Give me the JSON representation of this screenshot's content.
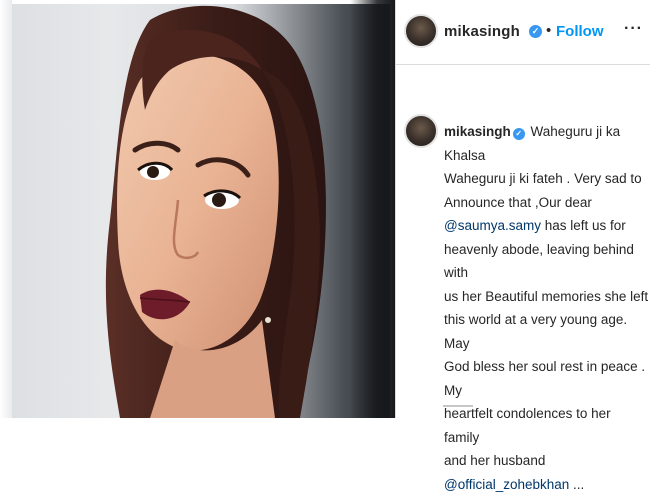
{
  "post": {
    "username": "mikasingh",
    "follow_label": "Follow",
    "separator": "•",
    "more_label": "···",
    "verified_mark": "✓"
  },
  "caption": {
    "username": "mikasingh",
    "line_1": "Waheguru ji ka Khalsa",
    "line_2": "Waheguru ji ki fateh . Very sad to",
    "line_3": "Announce that ,Our dear",
    "mention_1": "@saumya.samy",
    "line_4_rest": " has left us for",
    "line_5": "heavenly abode, leaving behind with",
    "line_6": "us her Beautiful memories she left",
    "line_7": "this world at a very young age. May",
    "line_8": "God bless her soul rest in peace . My",
    "line_9": "heartfelt condolences to her family",
    "line_10": "and her husband",
    "mention_2": "@official_zohebkhan",
    "ellipsis": " ..."
  },
  "icons": {
    "avatar": "profile-avatar",
    "verified": "verified-badge-icon",
    "more": "more-options-icon"
  },
  "colors": {
    "link_blue": "#0095f6",
    "verified_blue": "#3897f0",
    "mention": "#00376b",
    "text": "#262626"
  }
}
